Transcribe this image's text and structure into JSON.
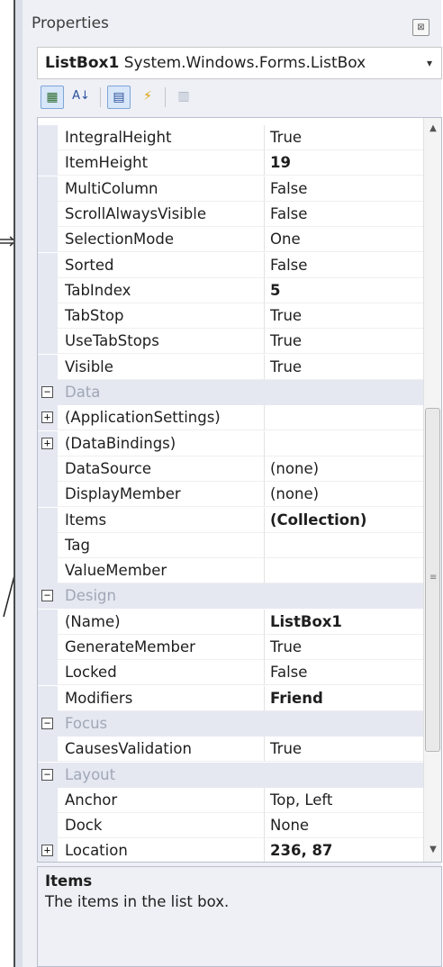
{
  "panel": {
    "title": "Properties",
    "close_glyph": "⊠"
  },
  "object_selector": {
    "name": "ListBox1",
    "type": "System.Windows.Forms.ListBox",
    "arrow": "▾"
  },
  "toolbar": {
    "categorized": "▦",
    "alphabetical": "A↓",
    "properties": "▤",
    "events": "⚡",
    "property_pages": "▥"
  },
  "rows": [
    {
      "kind": "prop",
      "name": "IntegralHeight",
      "value": "True",
      "bold": false
    },
    {
      "kind": "prop",
      "name": "ItemHeight",
      "value": "19",
      "bold": true
    },
    {
      "kind": "prop",
      "name": "MultiColumn",
      "value": "False",
      "bold": false
    },
    {
      "kind": "prop",
      "name": "ScrollAlwaysVisible",
      "value": "False",
      "bold": false
    },
    {
      "kind": "prop",
      "name": "SelectionMode",
      "value": "One",
      "bold": false
    },
    {
      "kind": "prop",
      "name": "Sorted",
      "value": "False",
      "bold": false
    },
    {
      "kind": "prop",
      "name": "TabIndex",
      "value": "5",
      "bold": true
    },
    {
      "kind": "prop",
      "name": "TabStop",
      "value": "True",
      "bold": false
    },
    {
      "kind": "prop",
      "name": "UseTabStops",
      "value": "True",
      "bold": false
    },
    {
      "kind": "prop",
      "name": "Visible",
      "value": "True",
      "bold": false
    },
    {
      "kind": "cat",
      "name": "Data",
      "toggle": "−"
    },
    {
      "kind": "prop",
      "name": "(ApplicationSettings)",
      "value": "",
      "bold": false,
      "toggle": "+"
    },
    {
      "kind": "prop",
      "name": "(DataBindings)",
      "value": "",
      "bold": false,
      "toggle": "+"
    },
    {
      "kind": "prop",
      "name": "DataSource",
      "value": "(none)",
      "bold": false
    },
    {
      "kind": "prop",
      "name": "DisplayMember",
      "value": "(none)",
      "bold": false
    },
    {
      "kind": "prop",
      "name": "Items",
      "value": "(Collection)",
      "bold": true
    },
    {
      "kind": "prop",
      "name": "Tag",
      "value": "",
      "bold": false
    },
    {
      "kind": "prop",
      "name": "ValueMember",
      "value": "",
      "bold": false
    },
    {
      "kind": "cat",
      "name": "Design",
      "toggle": "−"
    },
    {
      "kind": "prop",
      "name": "(Name)",
      "value": "ListBox1",
      "bold": true
    },
    {
      "kind": "prop",
      "name": "GenerateMember",
      "value": "True",
      "bold": false
    },
    {
      "kind": "prop",
      "name": "Locked",
      "value": "False",
      "bold": false
    },
    {
      "kind": "prop",
      "name": "Modifiers",
      "value": "Friend",
      "bold": true
    },
    {
      "kind": "cat",
      "name": "Focus",
      "toggle": "−"
    },
    {
      "kind": "prop",
      "name": "CausesValidation",
      "value": "True",
      "bold": false
    },
    {
      "kind": "cat",
      "name": "Layout",
      "toggle": "−"
    },
    {
      "kind": "prop",
      "name": "Anchor",
      "value": "Top, Left",
      "bold": false
    },
    {
      "kind": "prop",
      "name": "Dock",
      "value": "None",
      "bold": false
    },
    {
      "kind": "prop",
      "name": "Location",
      "value": "236, 87",
      "bold": true,
      "toggle": "+"
    }
  ],
  "description": {
    "title": "Items",
    "text": "The items in the list box."
  },
  "colors": {
    "category_bg": "#e5e8f1",
    "category_text": "#a0a7b6",
    "toolbar_active": "#d7e6f8"
  }
}
